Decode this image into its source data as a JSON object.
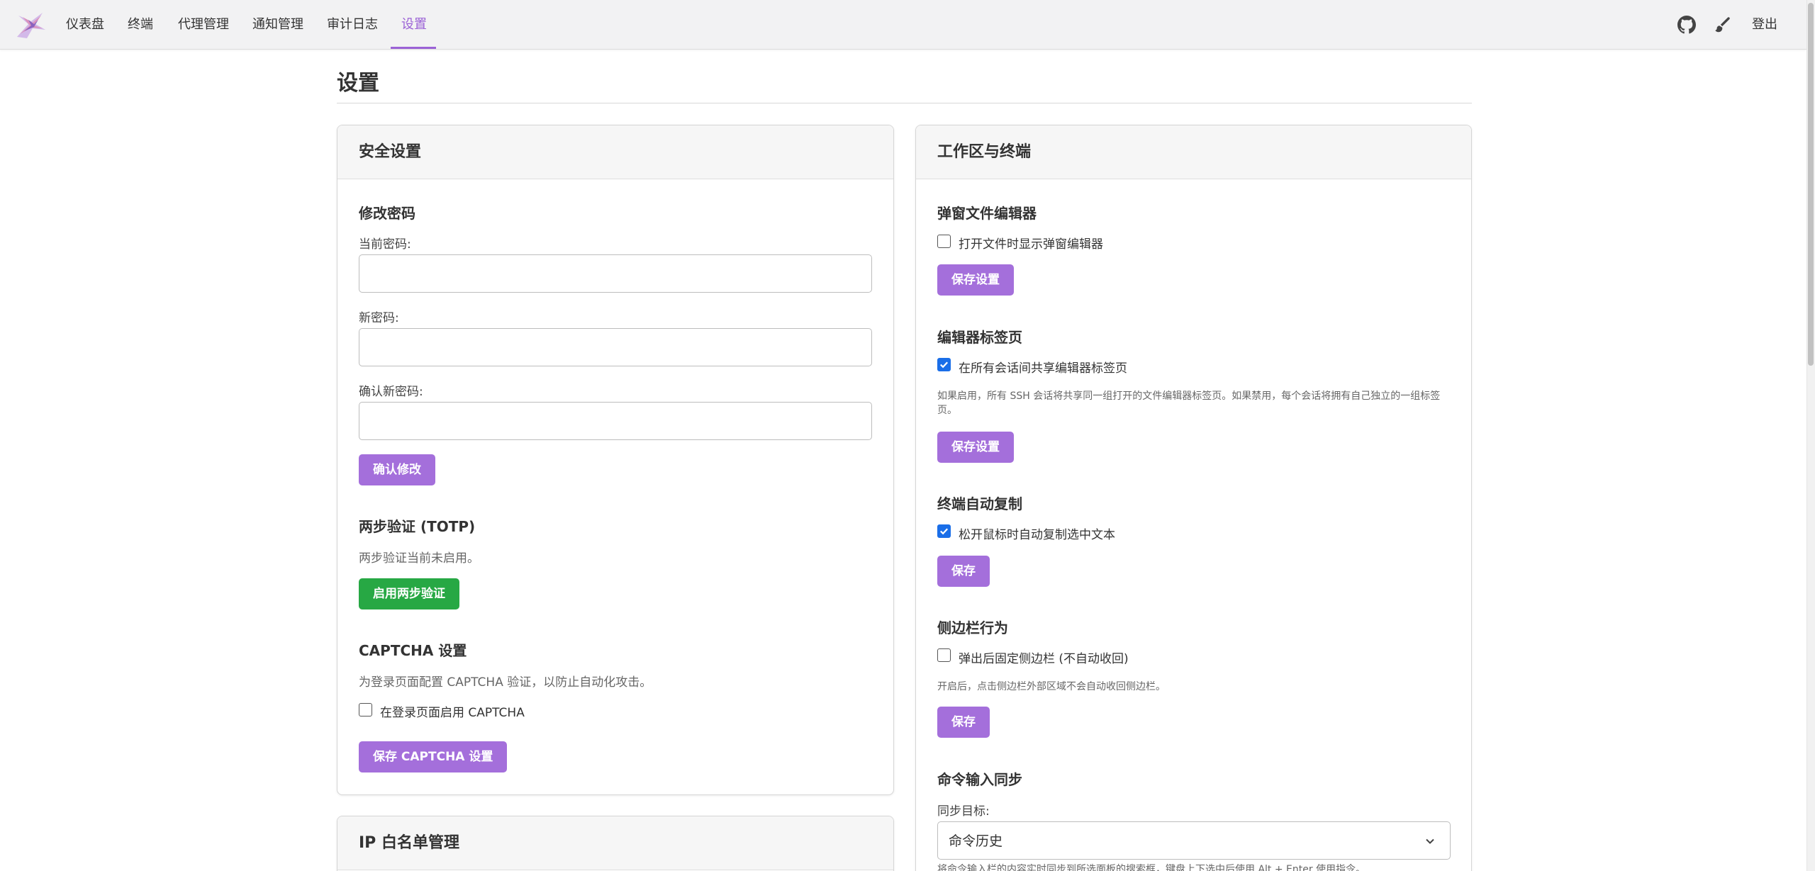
{
  "nav": {
    "items": [
      "仪表盘",
      "终端",
      "代理管理",
      "通知管理",
      "审计日志",
      "设置"
    ],
    "active": "设置",
    "logout": "登出",
    "icons": [
      "github-icon",
      "paintbrush-icon"
    ],
    "accent": "#9b62d6"
  },
  "page": {
    "title": "设置"
  },
  "security": {
    "title": "安全设置",
    "password": {
      "title": "修改密码",
      "current_label": "当前密码:",
      "new_label": "新密码:",
      "confirm_label": "确认新密码:",
      "submit": "确认修改"
    },
    "totp": {
      "title": "两步验证 (TOTP)",
      "status": "两步验证当前未启用。",
      "enable": "启用两步验证",
      "enable_color": "#27a844"
    },
    "captcha": {
      "title": "CAPTCHA 设置",
      "desc": "为登录页面配置 CAPTCHA 验证，以防止自动化攻击。",
      "checkbox": "在登录页面启用 CAPTCHA",
      "checked": false,
      "save": "保存 CAPTCHA 设置"
    }
  },
  "ip_whitelist": {
    "title": "IP 白名单管理"
  },
  "workspace": {
    "title": "工作区与终端",
    "popup_editor": {
      "title": "弹窗文件编辑器",
      "checkbox": "打开文件时显示弹窗编辑器",
      "checked": false,
      "save": "保存设置"
    },
    "editor_tabs": {
      "title": "编辑器标签页",
      "checkbox": "在所有会话间共享编辑器标签页",
      "checked": true,
      "desc": "如果启用，所有 SSH 会话将共享同一组打开的文件编辑器标签页。如果禁用，每个会话将拥有自己独立的一组标签页。",
      "save": "保存设置"
    },
    "auto_copy": {
      "title": "终端自动复制",
      "checkbox": "松开鼠标时自动复制选中文本",
      "checked": true,
      "save": "保存"
    },
    "sidebar": {
      "title": "侧边栏行为",
      "checkbox": "弹出后固定侧边栏 (不自动收回)",
      "checked": false,
      "desc": "开启后，点击侧边栏外部区域不会自动收回侧边栏。",
      "save": "保存"
    },
    "cmd_sync": {
      "title": "命令输入同步",
      "target_label": "同步目标:",
      "target_value": "命令历史",
      "desc": "将命令输入栏的内容实时同步到所选面板的搜索框，键盘上下选中后使用 Alt + Enter 使用指令。"
    }
  }
}
